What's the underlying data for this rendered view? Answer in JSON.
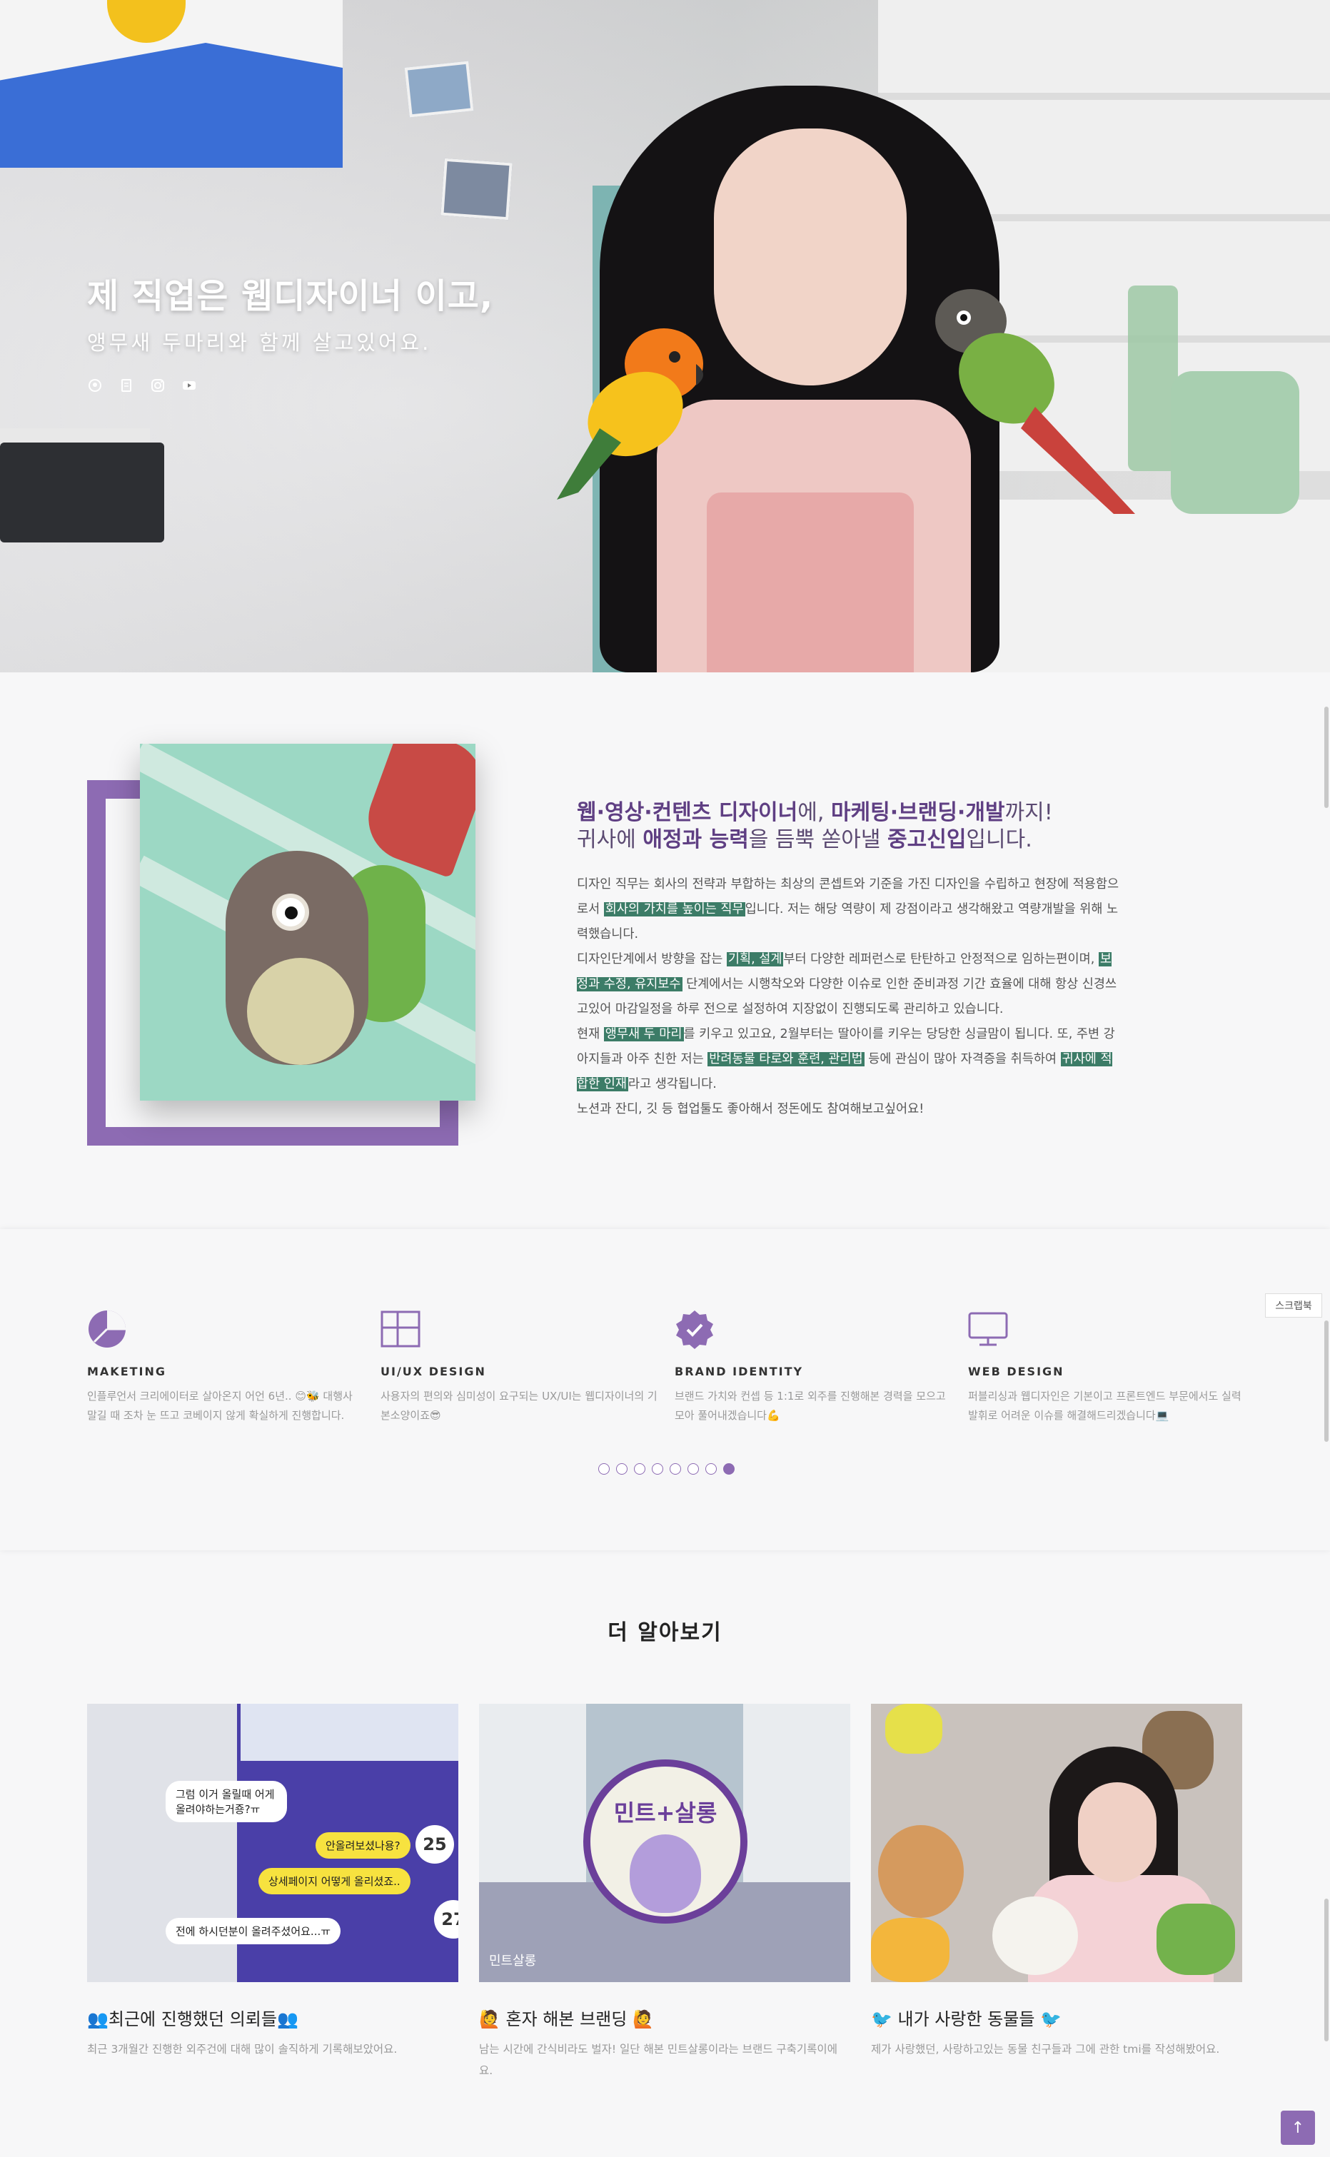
{
  "hero": {
    "title": "제 직업은 웹디자이너 이고,",
    "subtitle": "앵무새 두마리와 함께 살고있어요.",
    "icons": [
      "github-icon",
      "blog-icon",
      "instagram-icon",
      "youtube-icon"
    ]
  },
  "about": {
    "heading_line1": [
      {
        "text": "웹·영상·컨텐츠 디자이너",
        "strong": true
      },
      {
        "text": "에, ",
        "strong": false
      },
      {
        "text": "마케팅·브랜딩·개발",
        "strong": true
      },
      {
        "text": "까지!",
        "strong": false
      }
    ],
    "heading_line2": [
      {
        "text": "귀사에 ",
        "strong": false
      },
      {
        "text": "애정과 능력",
        "strong": true
      },
      {
        "text": "을 듬뿍 쏟아낼 ",
        "strong": false
      },
      {
        "text": "중고신입",
        "strong": true
      },
      {
        "text": "입니다.",
        "strong": false
      }
    ],
    "paragraphs": [
      [
        {
          "text": "디자인 직무는 회사의 전략과 부합하는 최상의 콘셉트와 기준을 가진 디자인을 수립하고 현장에 적용함으로서 ",
          "hl": false
        },
        {
          "text": "회사의 가치를 높이는 직무",
          "hl": true
        },
        {
          "text": "입니다. 저는 해당 역량이 제 강점이라고 생각해왔고 역량개발을 위해 노력했습니다.",
          "hl": false
        }
      ],
      [
        {
          "text": "디자인단계에서 방향을 잡는 ",
          "hl": false
        },
        {
          "text": "기획, 설계",
          "hl": true
        },
        {
          "text": "부터 다양한 레퍼런스로 탄탄하고 안정적으로 임하는편이며, ",
          "hl": false
        },
        {
          "text": "보정과 수정, 유지보수",
          "hl": true
        },
        {
          "text": " 단계에서는 시행착오와 다양한 이슈로 인한 준비과정 기간 효율에 대해 항상 신경쓰고있어 마감일정을 하루 전으로 설정하여 지장없이 진행되도록 관리하고 있습니다.",
          "hl": false
        }
      ],
      [
        {
          "text": "현재 ",
          "hl": false
        },
        {
          "text": "앵무새 두 마리",
          "hl": true
        },
        {
          "text": "를 키우고 있고요, 2월부터는 딸아이를 키우는 당당한 싱글맘이 됩니다. 또, 주변 강아지들과 아주 친한 저는 ",
          "hl": false
        },
        {
          "text": "반려동물 타로와 훈련, 관리법",
          "hl": true
        },
        {
          "text": " 등에 관심이 많아 자격증을 취득하여 ",
          "hl": false
        },
        {
          "text": "귀사에 적합한 인재",
          "hl": true
        },
        {
          "text": "라고 생각됩니다.",
          "hl": false
        }
      ],
      [
        {
          "text": "노션과 잔디, 깃 등 협업툴도 좋아해서 정돈에도 참여해보고싶어요!",
          "hl": false
        }
      ]
    ]
  },
  "skills": [
    {
      "icon": "pie-chart-icon",
      "title": "MAKETING",
      "desc": "인플루언서 크리에이터로 살아온지 어언 6년.. 😊🐝 대행사 말길 때 조차 눈 뜨고 코베이지 않게 확실하게 진행합니다."
    },
    {
      "icon": "layout-icon",
      "title": "UI/UX DESIGN",
      "desc": "사용자의 편의와 심미성이 요구되는 UX/UI는 웹디자이너의 기본소양이죠😎"
    },
    {
      "icon": "badge-check-icon",
      "title": "BRAND IDENTITY",
      "desc": "브랜드 가치와 컨셉 등 1:1로 외주를 진행해본 경력을 모으고 모아 풀어내겠습니다💪"
    },
    {
      "icon": "monitor-icon",
      "title": "WEB DESIGN",
      "desc": "퍼블리싱과 웹디자인은 기본이고 프론트엔드 부문에서도 실력발휘로 어려운 이슈를 해결해드리겠습니다💻"
    }
  ],
  "slider": {
    "count": 8,
    "active_index": 7
  },
  "scrap_label": "스크랩북",
  "more": {
    "title": "더 알아보기",
    "cards": [
      {
        "title": "👥최근에 진행했던 의뢰들👥",
        "desc": "최근 3개월간 진행한 외주건에 대해 많이 솔직하게 기록해보았어요.",
        "chat": [
          "그럼 이거 올릴때 어게 올려야하는거죵?ㅠ",
          "안올려보셨나용?",
          "상세페이지 어떻게 올리셨죠..",
          "전에 하시던분이 올려주셨어요...ㅠ"
        ],
        "badges": [
          "25",
          "27"
        ]
      },
      {
        "title": "🙋 혼자 해본 브랜딩 🙋",
        "desc": "남는 시간에 간식비라도 벌자! 일단 해본 민트살롱이라는 브랜드 구축기록이에요.",
        "logo_text": "민트+살롱",
        "image_label": "민트살롱"
      },
      {
        "title": "🐦 내가 사랑한 동물들 🐦",
        "desc": "제가 사랑했던, 사랑하고있는 동물 친구들과 그에 관한 tmi를 작성해봤어요."
      }
    ]
  },
  "top_button": "↑",
  "colors": {
    "accent": "#8d6bb3",
    "highlight": "#3c7c67",
    "heading": "#5f3f83"
  }
}
